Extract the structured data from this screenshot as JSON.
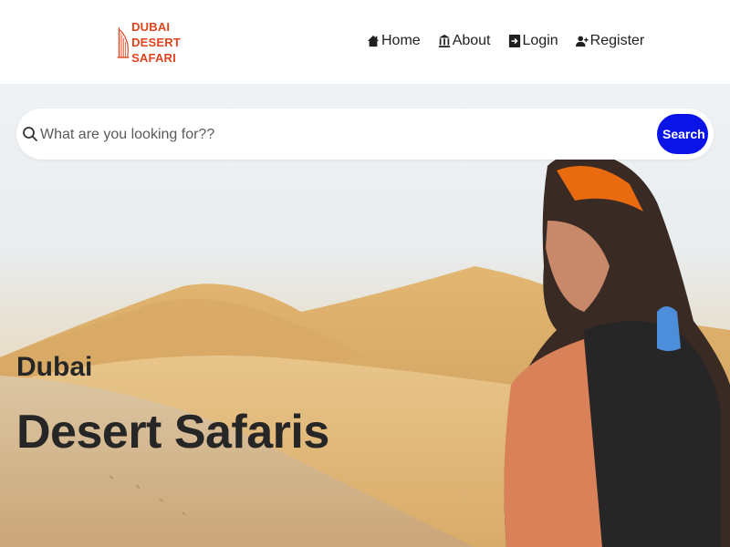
{
  "brand": {
    "name_lines": [
      "DUBAI",
      "DESERT",
      "SAFARI"
    ],
    "color": "#e0441c",
    "icon": "burj-al-arab-icon"
  },
  "nav": {
    "items": [
      {
        "label": "Home",
        "icon": "home-icon"
      },
      {
        "label": "About",
        "icon": "bank-icon"
      },
      {
        "label": "Login",
        "icon": "login-icon"
      },
      {
        "label": "Register",
        "icon": "user-plus-icon"
      }
    ]
  },
  "search": {
    "placeholder": "What are you looking for??",
    "button_label": "Search",
    "button_color": "#0a14e6",
    "icon": "search-icon"
  },
  "hero": {
    "subtitle": "Dubai",
    "title": "Desert Safaris"
  }
}
